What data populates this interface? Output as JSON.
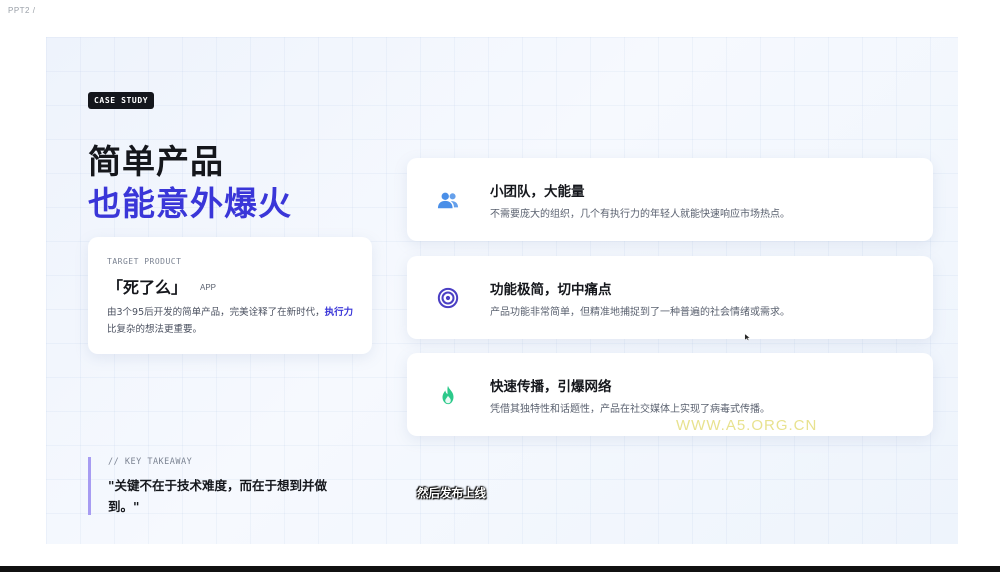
{
  "window": {
    "breadcrumb": "PPT2  /"
  },
  "slide": {
    "badge": "CASE STUDY",
    "title_line1": "简单产品",
    "title_line2": "也能意外爆火",
    "product": {
      "label": "TARGET PRODUCT",
      "name": "「死了么」",
      "tag": "APP",
      "desc_prefix": "由3个95后开发的简单产品，完美诠释了在新时代，",
      "desc_highlight": "执行力",
      "desc_suffix": "比复杂的想法更重要。"
    },
    "features": [
      {
        "icon": "users-icon",
        "title": "小团队，大能量",
        "desc": "不需要庞大的组织，几个有执行力的年轻人就能快速响应市场热点。",
        "color": "#4a8fe8"
      },
      {
        "icon": "target-icon",
        "title": "功能极简，切中痛点",
        "desc": "产品功能非常简单，但精准地捕捉到了一种普遍的社会情绪或需求。",
        "color": "#4b3fc4"
      },
      {
        "icon": "flame-icon",
        "title": "快速传播，引爆网络",
        "desc": "凭借其独特性和话题性，产品在社交媒体上实现了病毒式传播。",
        "color": "#2cc98a"
      }
    ],
    "takeaway": {
      "label": "// KEY TAKEAWAY",
      "quote": "\"关键不在于技术难度，而在于想到并做到。\""
    }
  },
  "overlay": {
    "watermark": "WWW.A5.ORG.CN",
    "subtitle": "然后发布上线"
  },
  "colors": {
    "accent": "#3a36d8",
    "badge_bg": "#14161c",
    "takeaway_bar": "#a79cf2"
  }
}
